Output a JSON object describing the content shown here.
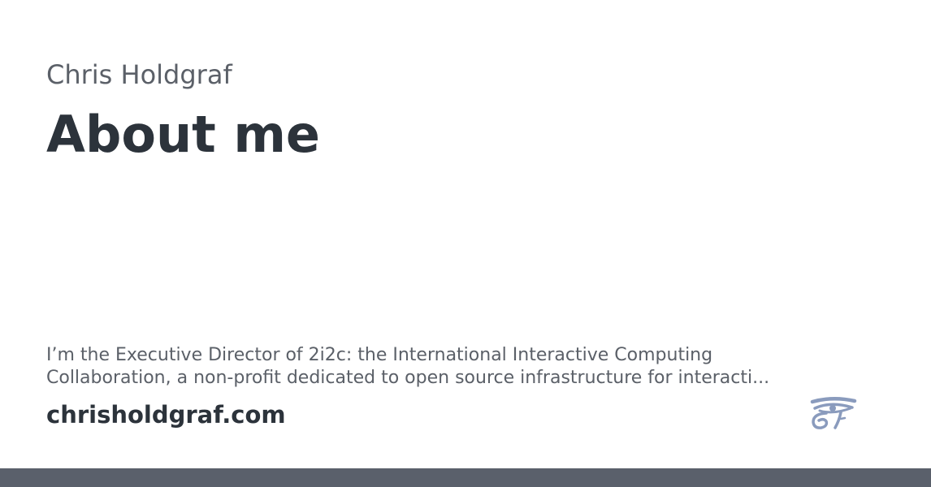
{
  "card": {
    "site_name": "Chris Holdgraf",
    "title": "About me",
    "description_line1": "I’m the Executive Director of 2i2c: the International Interactive Computing",
    "description_line2": "Collaboration, a non-profit dedicated to open source infrastructure for interacti...",
    "domain": "chrisholdgraf.com",
    "logo_icon": "eye-of-horus-icon"
  },
  "colors": {
    "background": "#ffffff",
    "heading": "#2c333b",
    "muted_text": "#5b6068",
    "logo": "#8a9bbd",
    "bottom_bar": "#5a606b"
  }
}
